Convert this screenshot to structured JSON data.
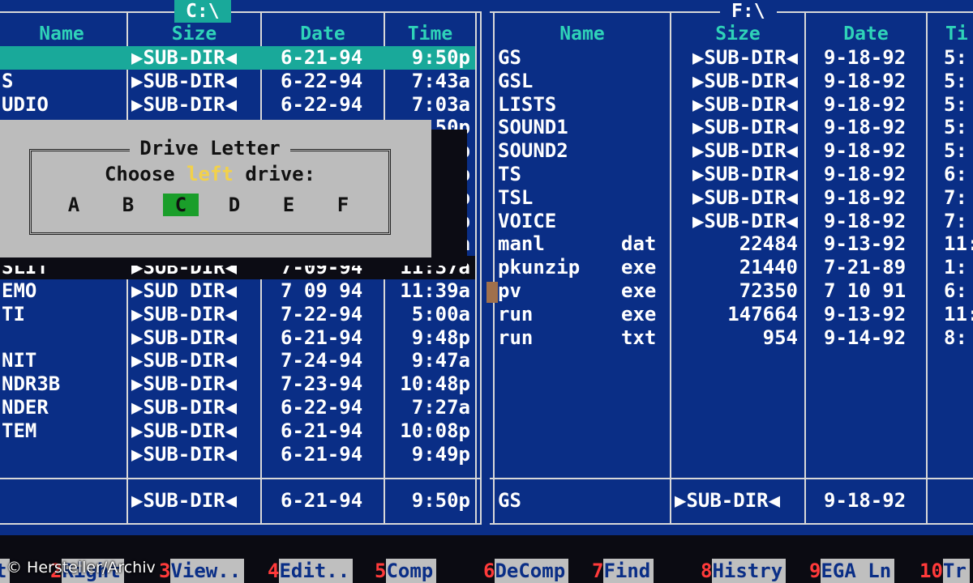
{
  "left_panel": {
    "drive": "C:\\",
    "columns": [
      "Name",
      "Size",
      "Date",
      "Time"
    ],
    "rows": [
      {
        "name": "",
        "size": "▶SUB-DIR◀",
        "date": "6-21-94",
        "time": "9:50p",
        "selected": true
      },
      {
        "name": "S",
        "size": "▶SUB-DIR◀",
        "date": "6-22-94",
        "time": "7:43a"
      },
      {
        "name": "UDIO",
        "size": "▶SUB-DIR◀",
        "date": "6-22-94",
        "time": "7:03a"
      },
      {
        "name": "",
        "size": "",
        "date": "",
        "time": "50p"
      },
      {
        "name": "",
        "size": "",
        "date": "",
        "time": "46p"
      },
      {
        "name": "",
        "size": "",
        "date": "",
        "time": "28p"
      },
      {
        "name": "",
        "size": "",
        "date": "",
        "time": "51p"
      },
      {
        "name": "",
        "size": "",
        "date": "",
        "time": "53p"
      },
      {
        "name": "",
        "size": "",
        "date": "",
        "time": "52a"
      },
      {
        "name": "SLIT",
        "size": "▶SUB-DIR◀",
        "date": "7-09-94",
        "time": "11:37a",
        "dark": true
      },
      {
        "name": "EMO",
        "size": "▶SUD DIR◀",
        "date": "7 09 94",
        "time": "11:39a"
      },
      {
        "name": "TI",
        "size": "▶SUB-DIR◀",
        "date": "7-22-94",
        "time": "5:00a"
      },
      {
        "name": "",
        "size": "▶SUB-DIR◀",
        "date": "6-21-94",
        "time": "9:48p"
      },
      {
        "name": "NIT",
        "size": "▶SUB-DIR◀",
        "date": "7-24-94",
        "time": "9:47a"
      },
      {
        "name": "NDR3B",
        "size": "▶SUB-DIR◀",
        "date": "7-23-94",
        "time": "10:48p"
      },
      {
        "name": "NDER",
        "size": "▶SUB-DIR◀",
        "date": "6-22-94",
        "time": "7:27a"
      },
      {
        "name": "TEM",
        "size": "▶SUB-DIR◀",
        "date": "6-21-94",
        "time": "10:08p"
      },
      {
        "name": "",
        "size": "▶SUB-DIR◀",
        "date": "6-21-94",
        "time": "9:49p"
      }
    ],
    "status": {
      "size": "▶SUB-DIR◀",
      "date": "6-21-94",
      "time": "9:50p"
    }
  },
  "right_panel": {
    "drive": "F:\\",
    "columns": [
      "Name",
      "Size",
      "Date",
      "Ti"
    ],
    "rows": [
      {
        "name": "GS",
        "ext": "",
        "size": "▶SUB-DIR◀",
        "date": "9-18-92",
        "time": "5:"
      },
      {
        "name": "GSL",
        "ext": "",
        "size": "▶SUB-DIR◀",
        "date": "9-18-92",
        "time": "5:"
      },
      {
        "name": "LISTS",
        "ext": "",
        "size": "▶SUB-DIR◀",
        "date": "9-18-92",
        "time": "5:"
      },
      {
        "name": "SOUND1",
        "ext": "",
        "size": "▶SUB-DIR◀",
        "date": "9-18-92",
        "time": "5:"
      },
      {
        "name": "SOUND2",
        "ext": "",
        "size": "▶SUB-DIR◀",
        "date": "9-18-92",
        "time": "5:"
      },
      {
        "name": "TS",
        "ext": "",
        "size": "▶SUB-DIR◀",
        "date": "9-18-92",
        "time": "6:"
      },
      {
        "name": "TSL",
        "ext": "",
        "size": "▶SUB-DIR◀",
        "date": "9-18-92",
        "time": "7:"
      },
      {
        "name": "VOICE",
        "ext": "",
        "size": "▶SUB-DIR◀",
        "date": "9-18-92",
        "time": "7:"
      },
      {
        "name": "manl",
        "ext": "dat",
        "size": "22484",
        "date": "9-13-92",
        "time": "11:"
      },
      {
        "name": "pkunzip",
        "ext": "exe",
        "size": "21440",
        "date": "7-21-89",
        "time": "1:"
      },
      {
        "name": "pv",
        "ext": "exe",
        "size": "72350",
        "date": "7 10 91",
        "time": "6:"
      },
      {
        "name": "run",
        "ext": "exe",
        "size": "147664",
        "date": "9-13-92",
        "time": "11:"
      },
      {
        "name": "run",
        "ext": "txt",
        "size": "954",
        "date": "9-14-92",
        "time": "8:"
      }
    ],
    "status": {
      "name": "GS",
      "size": "▶SUB-DIR◀",
      "date": "9-18-92"
    }
  },
  "dialog": {
    "title": "Drive Letter",
    "prompt_before": "Choose ",
    "prompt_highlight": "left",
    "prompt_after": " drive:",
    "drives": [
      "A",
      "B",
      "C",
      "D",
      "E",
      "F"
    ],
    "selected_drive": "C"
  },
  "function_keys": [
    {
      "num": "",
      "label": "t"
    },
    {
      "num": "2",
      "label": "Right"
    },
    {
      "num": "3",
      "label": "View.."
    },
    {
      "num": "4",
      "label": "Edit.."
    },
    {
      "num": "5",
      "label": "Comp"
    },
    {
      "num": "6",
      "label": "DeComp"
    },
    {
      "num": "7",
      "label": "Find"
    },
    {
      "num": "8",
      "label": "Histry"
    },
    {
      "num": "9",
      "label": "EGA Ln"
    },
    {
      "num": "10",
      "label": "Tr"
    }
  ],
  "credit": "© Hersteller/Archiv",
  "colors": {
    "panel": "#0a2e86",
    "highlight": "#19a99a",
    "header": "#2fd3b8",
    "fkey_num": "#ff3a3a",
    "dialog": "#bcbcbc",
    "selected_drive": "#1a9e2a"
  }
}
